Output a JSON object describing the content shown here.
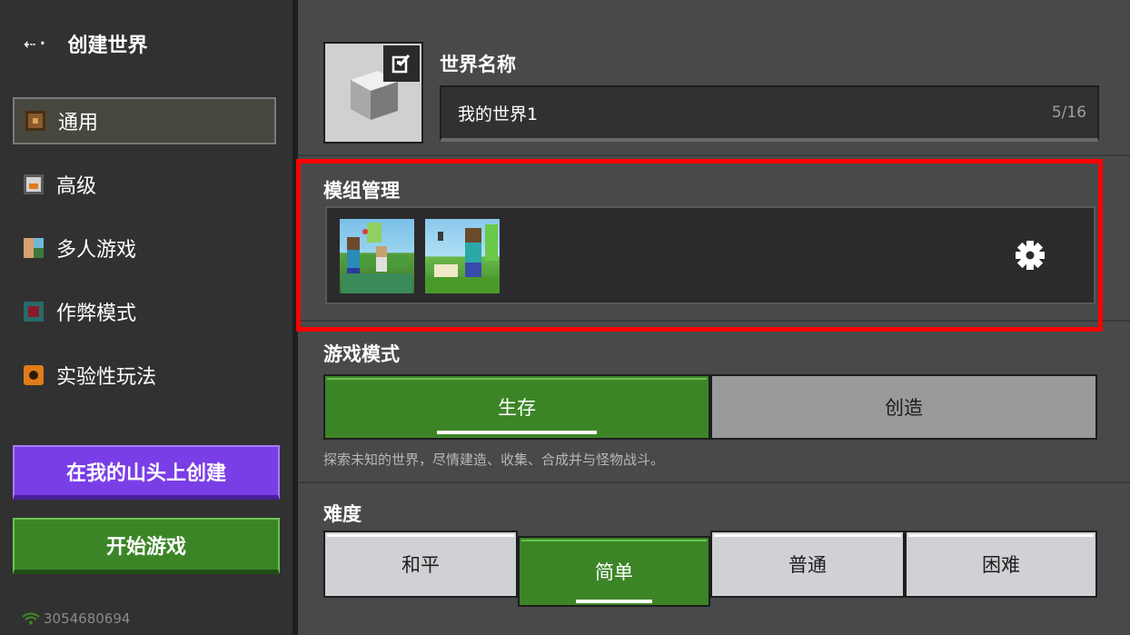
{
  "header": {
    "back_icon": "⇠·",
    "title": "创建世界"
  },
  "sidebar": {
    "items": [
      {
        "label": "通用",
        "icon": "general-icon",
        "active": true
      },
      {
        "label": "高级",
        "icon": "furnace-icon"
      },
      {
        "label": "多人游戏",
        "icon": "players-icon"
      },
      {
        "label": "作弊模式",
        "icon": "command-block-icon"
      },
      {
        "label": "实验性玩法",
        "icon": "experiments-icon"
      }
    ],
    "realm_button": "在我的山头上创建",
    "play_button": "开始游戏",
    "network_id": "3054680694"
  },
  "world": {
    "name_label": "世界名称",
    "name_value": "我的世界1",
    "name_count": "5/16"
  },
  "mods": {
    "label": "模组管理",
    "packs": [
      "pack-thumbnail-1",
      "pack-thumbnail-2"
    ],
    "gear_icon": "gear-icon",
    "highlight_color": "#ff0000"
  },
  "game_mode": {
    "label": "游戏模式",
    "options": [
      "生存",
      "创造"
    ],
    "selected": "生存",
    "description": "探索未知的世界，尽情建造、收集、合成并与怪物战斗。"
  },
  "difficulty": {
    "label": "难度",
    "options": [
      "和平",
      "简单",
      "普通",
      "困难"
    ],
    "selected": "简单"
  },
  "colors": {
    "green": "#3c8527",
    "purple": "#7a3ee6",
    "panel": "#48494a",
    "sidebar": "#313131"
  }
}
